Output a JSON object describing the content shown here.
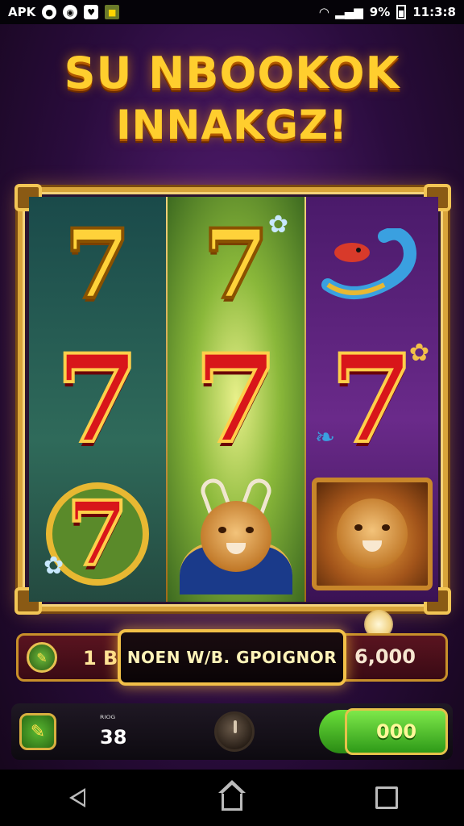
{
  "status_bar": {
    "left_text": "APK",
    "battery_percent": "9%",
    "time": "11:3:8"
  },
  "title": {
    "line1": "SU NBOOKOK",
    "line2": "INNAKGZ!"
  },
  "reels": [
    [
      "gold-seven",
      "red-seven",
      "ringed-seven"
    ],
    [
      "gold-seven",
      "red-seven",
      "bull"
    ],
    [
      "snake",
      "wrapped-seven",
      "lion"
    ]
  ],
  "symbols": {
    "seven": "7"
  },
  "bet_bar": {
    "bet_label": "1 B.C",
    "banner_text": "NOEN W/B. GPOIGNOR",
    "win_value": "6,000"
  },
  "controls": {
    "lines_label": "ᴿᴵᴼᴳ",
    "lines_value": "38",
    "spin_label": "000"
  },
  "colors": {
    "accent_gold": "#d8a43a",
    "spin_green": "#2e9a18",
    "background_purple": "#5a1f7a"
  }
}
